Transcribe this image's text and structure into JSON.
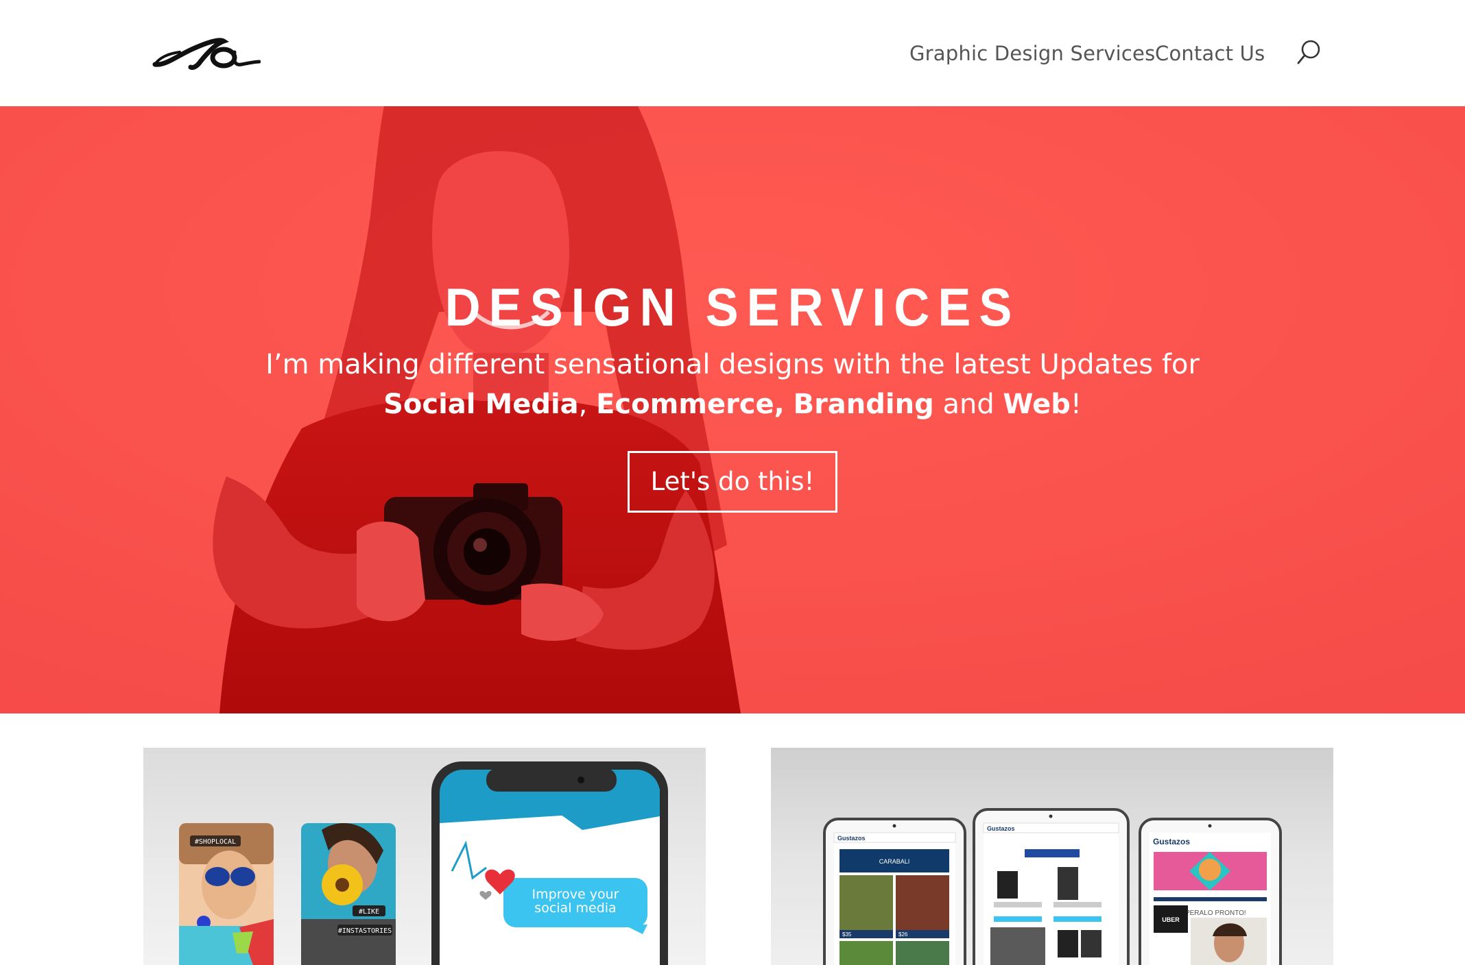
{
  "header": {
    "nav": [
      {
        "label": "Graphic Design Services"
      },
      {
        "label": "Contact Us"
      }
    ]
  },
  "hero": {
    "title": "DESIGN SERVICES",
    "subtitle_line1": "I’m making different sensational designs with the latest Updates for",
    "subtitle_line2": {
      "social": "Social Media",
      "sep1": ", ",
      "ecommerce": "Ecommerce,",
      "sep2": " ",
      "branding": "Branding",
      "and": " and ",
      "web": "Web",
      "end": "!"
    },
    "cta_label": "Let's do this!"
  },
  "portfolio": {
    "social_card": {
      "tag1": "#SHOPLOCAL",
      "tag2": "#LIKE",
      "tag3": "#INSTASTORIES",
      "bubble_line1": "Improve your",
      "bubble_line2": "social media"
    },
    "ecommerce_card": {
      "brand1": "Gustazos",
      "brand2": "Gustazos",
      "brand3": "Gustazos",
      "promo": "CARABALI",
      "price1": "$35",
      "price2": "$26",
      "coming": "¡ESPERALO PRONTO!",
      "uber": "UBER"
    }
  },
  "colors": {
    "hero_red": "#fa5050",
    "nav_text": "#555555",
    "bubble_blue": "#3cc4f0",
    "heart_red": "#e8303a"
  }
}
